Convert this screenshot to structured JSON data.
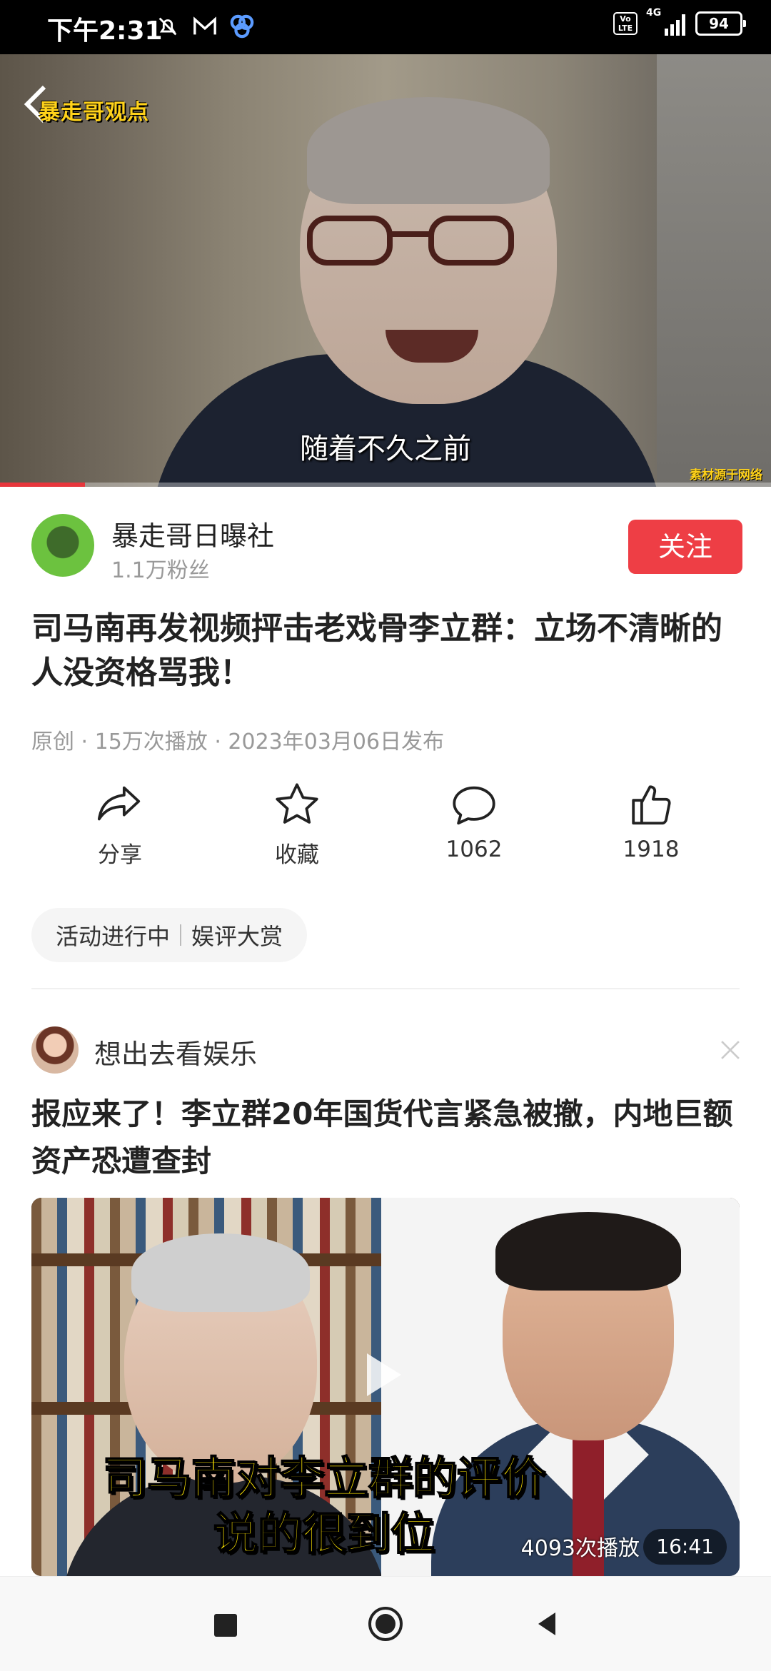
{
  "status_bar": {
    "time": "下午2:31",
    "network": "4G",
    "volte": "Vo LTE",
    "battery": "94"
  },
  "video": {
    "logo_text": "暴走哥观点",
    "subtitle": "随着不久之前",
    "credit": "素材源于网络",
    "progress": 0.11
  },
  "author": {
    "name": "暴走哥日曝社",
    "fans": "1.1万粉丝",
    "follow_label": "关注"
  },
  "article": {
    "title": "司马南再发视频抨击老戏骨李立群：立场不清晰的人没资格骂我！",
    "meta": "原创 · 15万次播放 · 2023年03月06日发布"
  },
  "actions": [
    {
      "icon": "share-icon",
      "label": "分享"
    },
    {
      "icon": "star-icon",
      "label": "收藏"
    },
    {
      "icon": "comment-icon",
      "label": "1062"
    },
    {
      "icon": "thumbs-up-icon",
      "label": "1918"
    }
  ],
  "activity": {
    "left": "活动进行中",
    "right": "娱评大赏"
  },
  "recommendation": {
    "author": "想出去看娱乐",
    "title": "报应来了！李立群20年国货代言紧急被撤，内地巨额资产恐遭查封",
    "thumb_caption_line1": "司马南对李立群的评价",
    "thumb_caption_line2": "说的很到位",
    "plays": "4093次播放",
    "duration": "16:41"
  },
  "colors": {
    "accent": "#ee3e45",
    "meta_text": "#999999"
  }
}
